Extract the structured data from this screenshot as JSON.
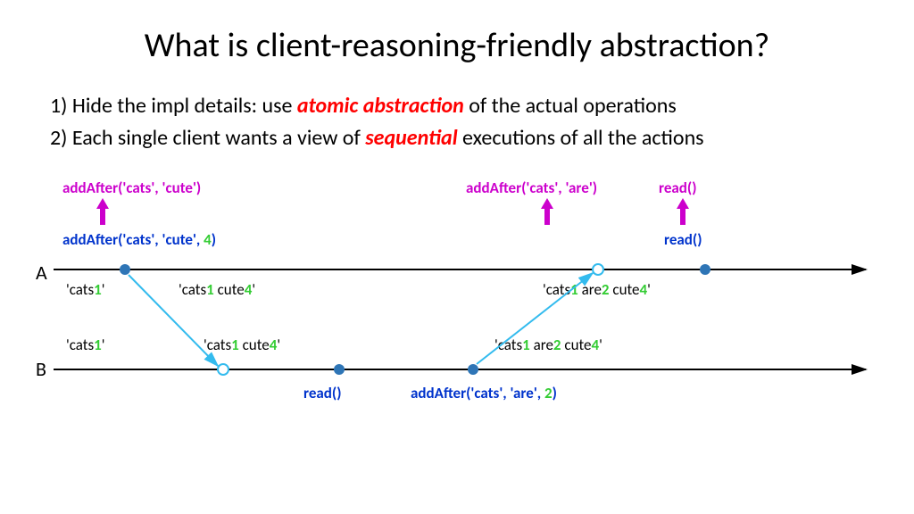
{
  "title": "What is client-reasoning-friendly abstraction?",
  "bullets": {
    "b1_pre": "1) Hide the impl details: use ",
    "b1_em": "atomic abstraction",
    "b1_post": " of the actual operations",
    "b2_pre": "2) Each single client wants a view of ",
    "b2_em": "sequential",
    "b2_post": " executions of all the actions"
  },
  "pink": {
    "addCute": "addAfter('cats', 'cute')",
    "addAre": "addAfter('cats', 'are')",
    "read": "read()"
  },
  "blueA": {
    "addCute_pre": "addAfter('cats', 'cute', ",
    "addCute_num": "4",
    "addCute_post": ")",
    "read": "read()"
  },
  "blueB": {
    "read": "read()",
    "addAre_pre": "addAfter('cats', 'are', ",
    "addAre_num": "2",
    "addAre_post": ")"
  },
  "states": {
    "a1": {
      "p0": "'cats",
      "n0": "1",
      "p1": "'"
    },
    "a2": {
      "p0": "'cats",
      "n0": "1",
      "p1": " cute",
      "n1": "4",
      "p2": "'"
    },
    "a3": {
      "p0": "'cats",
      "n0": "1",
      "p1": " are",
      "n1": "2",
      "p2": " cute",
      "n2": "4",
      "p3": "'"
    },
    "b1": {
      "p0": "'cats",
      "n0": "1",
      "p1": "'"
    },
    "b2": {
      "p0": "'cats",
      "n0": "1",
      "p1": " cute",
      "n1": "4",
      "p2": "'"
    },
    "b3": {
      "p0": "'cats",
      "n0": "1",
      "p1": " are",
      "n1": "2",
      "p2": " cute",
      "n2": "4",
      "p3": "'"
    }
  },
  "axes": {
    "A": "A",
    "B": "B"
  }
}
